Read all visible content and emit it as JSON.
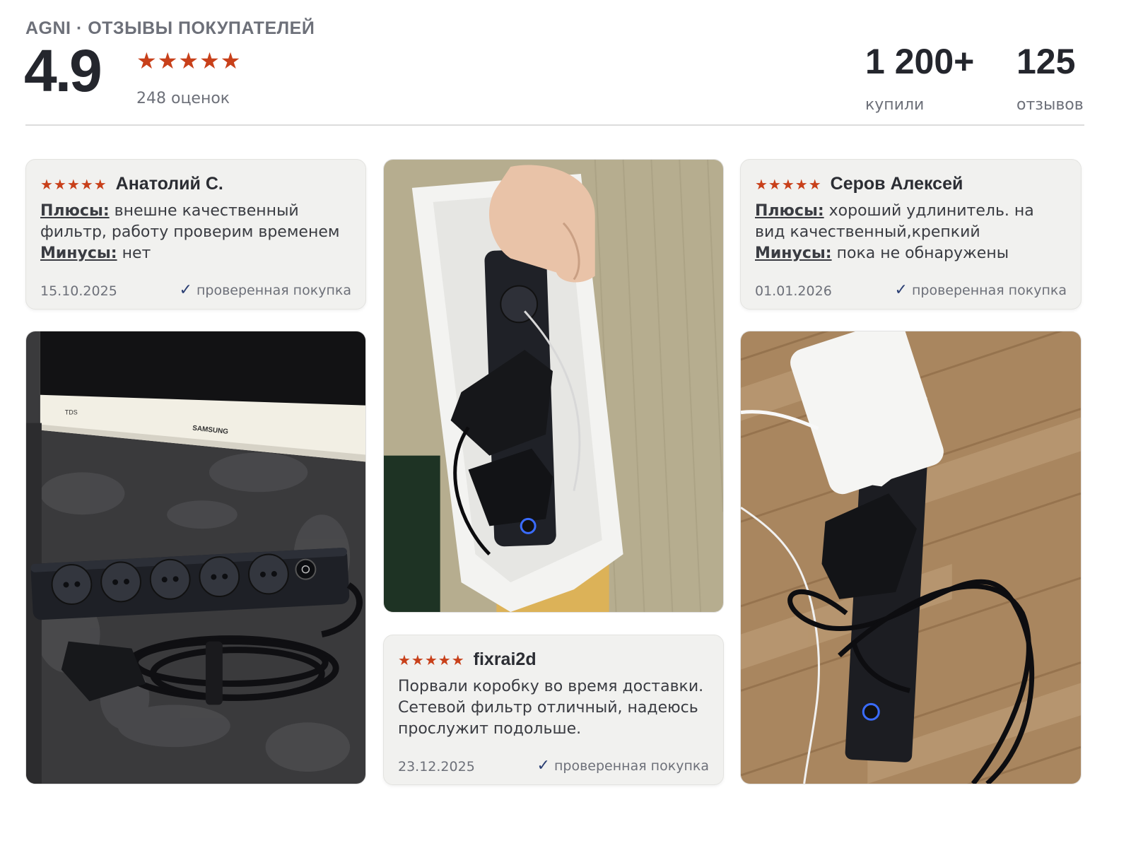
{
  "header": {
    "brand": "AGNI · ОТЗЫВЫ ПОКУПАТЕЛЕЙ",
    "rating": "4.9",
    "stars": "★★★★★",
    "ratings_count": "248 оценок"
  },
  "stats": {
    "bought_value": "1 200+",
    "bought_label": "купили",
    "reviews_value": "125",
    "reviews_label": "отзывов"
  },
  "reviews": [
    {
      "stars": "★★★★★",
      "author": "Анатолий С.",
      "pros_label": "Плюсы:",
      "pros": "внешне качественный фильтр, работу проверим временем",
      "cons_label": "Минусы:",
      "cons": "нет",
      "date": "15.10.2025",
      "verified": "проверенная покупка"
    },
    {
      "stars": "★★★★★",
      "author": "fixrai2d",
      "text": "Порвали коробку во время доставки. Сетевой фильтр отличный, надеюсь прослужит подольше.",
      "date": "23.12.2025",
      "verified": "проверенная покупка"
    },
    {
      "stars": "★★★★★",
      "author": "Серов Алексей",
      "pros_label": "Плюсы:",
      "pros": "хороший удлинитель. на вид качественный,крепкий",
      "cons_label": "Минусы:",
      "cons": "пока не обнаружены",
      "date": "01.01.2026",
      "verified": "проверенная покупка"
    }
  ],
  "photos": {
    "photo1_microwave_brand": "SAMSUNG",
    "photo1_microwave_label": "TDS"
  },
  "colors": {
    "star": "#c8401a",
    "check": "#2b3f73",
    "card_bg": "#f1f1ef"
  }
}
